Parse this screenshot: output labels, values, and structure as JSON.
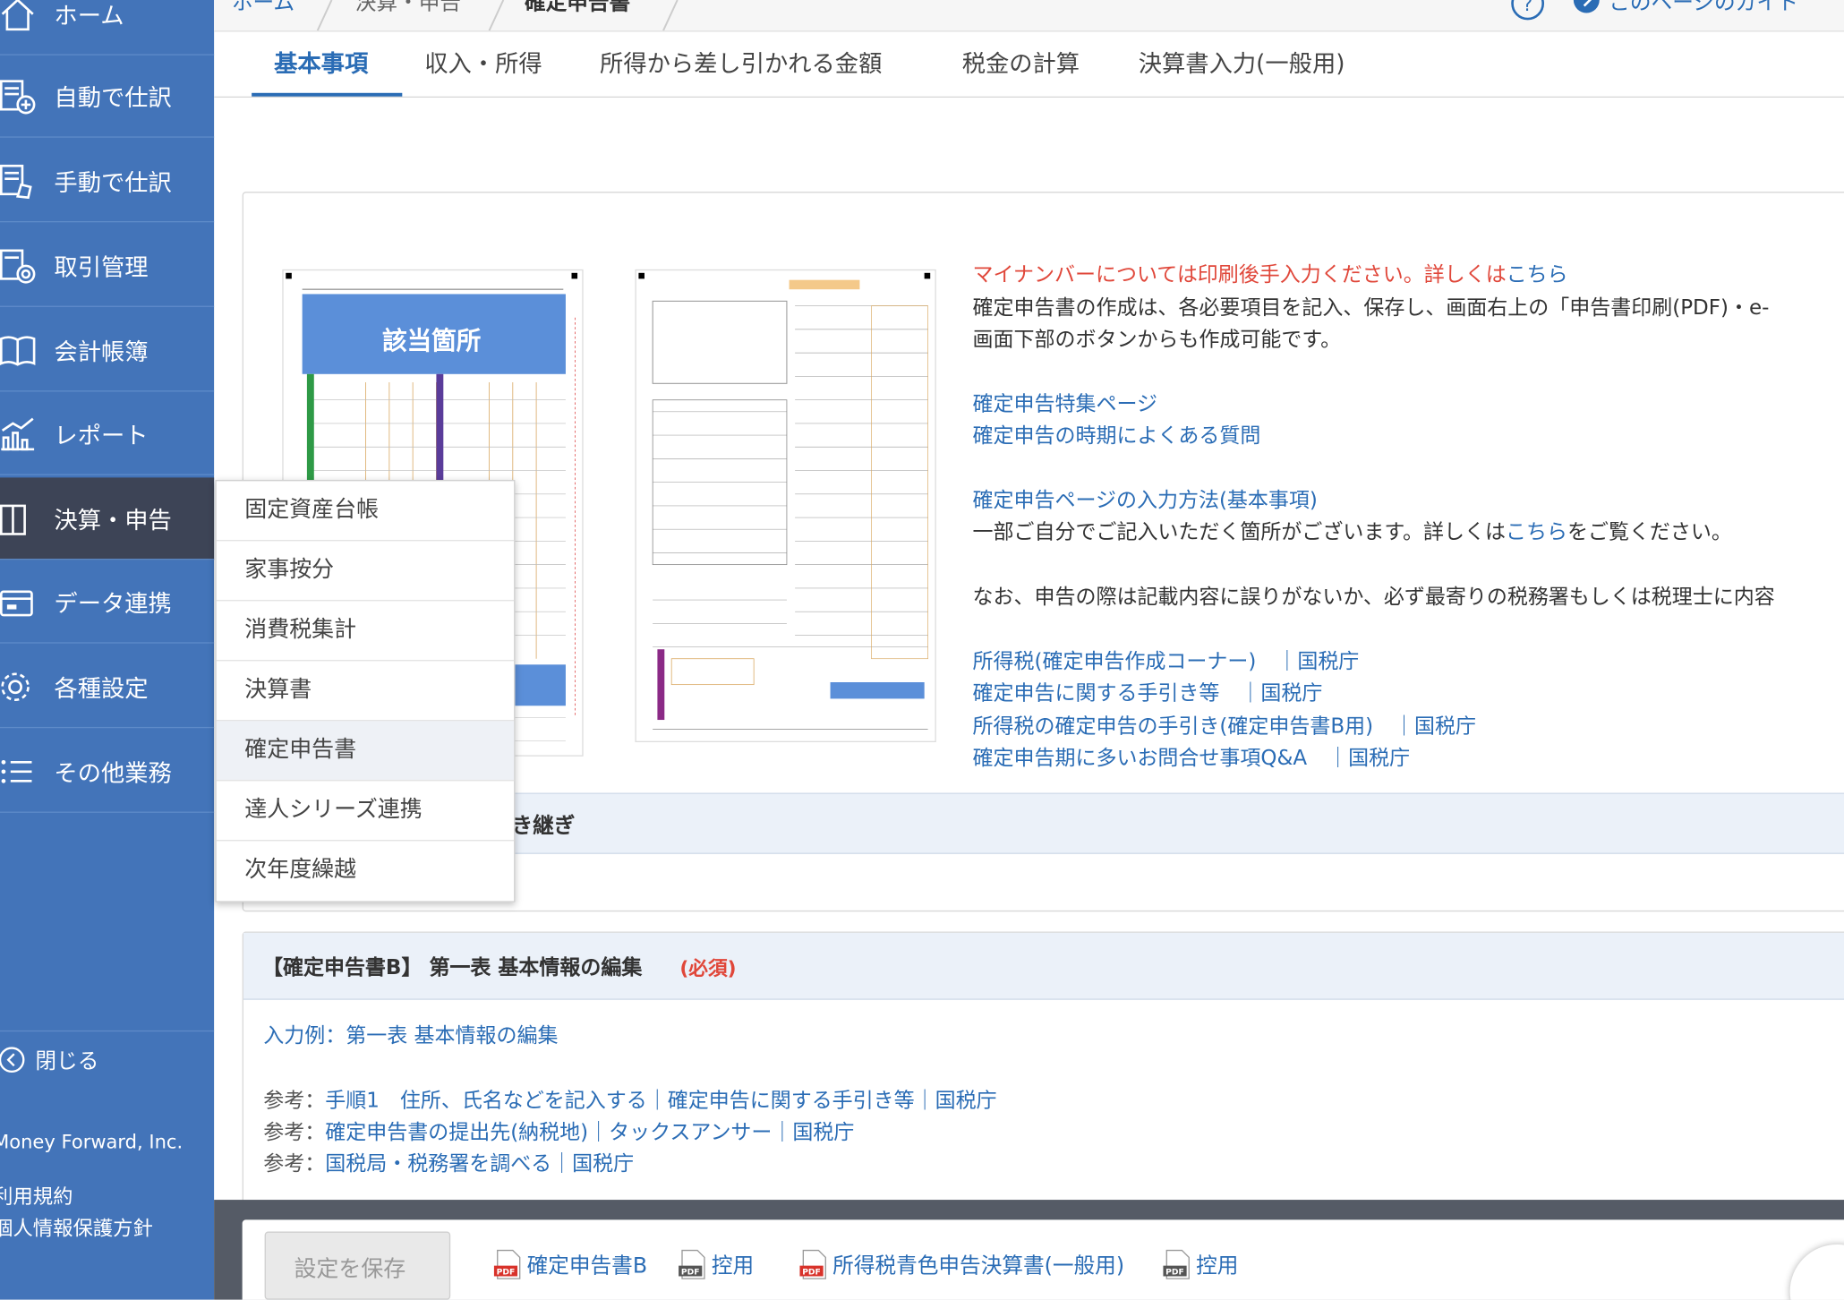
{
  "sidebar": {
    "items": [
      {
        "label": "ホーム",
        "icon": "home-icon"
      },
      {
        "label": "自動で仕訳",
        "icon": "auto-journal-icon"
      },
      {
        "label": "手動で仕訳",
        "icon": "manual-journal-icon"
      },
      {
        "label": "取引管理",
        "icon": "transaction-icon"
      },
      {
        "label": "会計帳簿",
        "icon": "book-icon"
      },
      {
        "label": "レポート",
        "icon": "report-chart-icon"
      },
      {
        "label": "決算・申告",
        "icon": "settlement-icon"
      },
      {
        "label": "データ連携",
        "icon": "data-link-icon"
      },
      {
        "label": "各種設定",
        "icon": "gear-icon"
      },
      {
        "label": "その他業務",
        "icon": "list-icon"
      }
    ],
    "close_label": "閉じる",
    "company": "Money Forward, Inc.",
    "terms": "利用規約",
    "privacy": "個人情報保護方針"
  },
  "breadcrumb": {
    "home": "ホーム",
    "parent": "決算・申告",
    "current": "確定申告書"
  },
  "guide_label": "このページのガイド",
  "tabs": [
    "基本事項",
    "収入・所得",
    "所得から差し引かれる金額",
    "税金の計算",
    "決算書入力(一般用)"
  ],
  "dropdown": [
    "固定資産台帳",
    "家事按分",
    "消費税集計",
    "決算書",
    "確定申告書",
    "達人シリーズ連携",
    "次年度繰越"
  ],
  "form_image_label": "該当箇所",
  "info": {
    "mynumber_text": "マイナンバーについては印刷後手入力ください。詳しくは",
    "mynumber_link": "こちら",
    "desc_line1": "確定申告書の作成は、各必要項目を記入、保存し、画面右上の「申告書印刷(PDF)・e-",
    "desc_line2": "画面下部のボタンからも作成可能です。",
    "link_special": "確定申告特集ページ",
    "link_faq": "確定申告の時期によくある質問",
    "link_input_method": "確定申告ページの入力方法(基本事項)",
    "note_prefix": "一部ご自分でご記入いただく箇所がございます。詳しくは",
    "note_link": "こちら",
    "note_suffix": "をご覧ください。",
    "warning": "なお、申告の際は記載内容に誤りがないか、必ず最寄りの税務署もしくは税理士に内容",
    "refs": [
      "所得税(確定申告作成コーナー)　｜国税庁",
      "確定申告に関する手引き等　｜国税庁",
      "所得税の確定申告の手引き(確定申告書B用)　｜国税庁",
      "確定申告期に多いお問合せ事項Q&A　｜国税庁"
    ]
  },
  "carryover_label": "き継ぎ",
  "section": {
    "title": "【確定申告書B】 第一表 基本情報の編集",
    "required": "(必須)",
    "example_link": "入力例：第一表 基本情報の編集",
    "ref_prefix": "参考：",
    "refs": [
      "手順1　住所、氏名などを記入する｜確定申告に関する手引き等｜国税庁",
      "確定申告書の提出先(納税地)｜タックスアンサー｜国税庁",
      "国税局・税務署を調べる｜国税庁"
    ]
  },
  "footer": {
    "save_button": "設定を保存",
    "pdf_icon_text": "PDF",
    "pdf_links": [
      "確定申告書B",
      "控用",
      "所得税青色申告決算書(一般用)",
      "控用"
    ]
  },
  "colors": {
    "sidebar": "#4374b9",
    "sidebar_active": "#3d4456",
    "accent": "#2a6cb5",
    "required": "#e0473a"
  }
}
